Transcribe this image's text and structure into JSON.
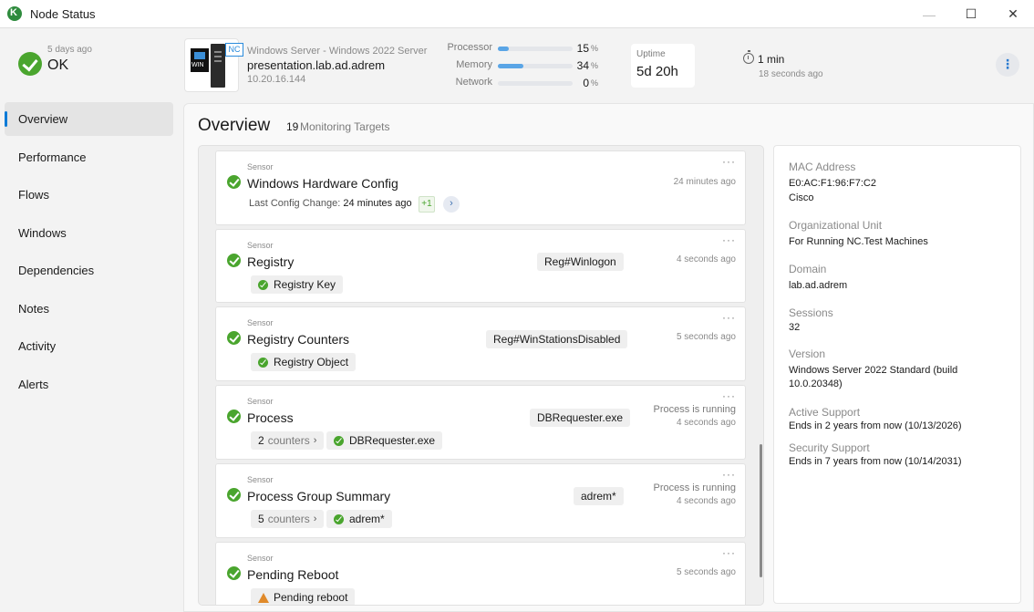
{
  "window": {
    "title": "Node Status",
    "minimize": "—",
    "maximize": "☐",
    "close": "✕"
  },
  "status": {
    "time": "5 days ago",
    "label": "OK"
  },
  "nav": [
    "Overview",
    "Performance",
    "Flows",
    "Windows",
    "Dependencies",
    "Notes",
    "Activity",
    "Alerts"
  ],
  "header": {
    "nc_badge": "NC",
    "win_text": "WIN",
    "os": "Windows Server - Windows 2022 Server",
    "host": "presentation.lab.ad.adrem",
    "ip": "10.20.16.144",
    "metrics": [
      {
        "label": "Processor",
        "value": "15",
        "unit": "%",
        "fraction": 0.15
      },
      {
        "label": "Memory",
        "value": "34",
        "unit": "%",
        "fraction": 0.34
      },
      {
        "label": "Network",
        "value": "0",
        "unit": "%",
        "fraction": 0.0
      }
    ],
    "uptime_label": "Uptime",
    "uptime_value": "5d 20h",
    "timer_value": "1 min",
    "timer_sub": "18 seconds ago",
    "more": "⋮"
  },
  "main": {
    "title": "Overview",
    "target_count": "19",
    "target_label": "Monitoring Targets"
  },
  "cards": [
    {
      "sensor": "Sensor",
      "name": "Windows Hardware Config",
      "time": "24 minutes ago",
      "cfg_label": "Last Config Change:",
      "cfg_value": "24 minutes ago",
      "plus": "+1",
      "next": "›"
    },
    {
      "sensor": "Sensor",
      "name": "Registry",
      "tag": "Reg#Winlogon",
      "time": "4 seconds ago",
      "chip": "Registry Key"
    },
    {
      "sensor": "Sensor",
      "name": "Registry Counters",
      "tag": "Reg#WinStationsDisabled",
      "time": "5 seconds ago",
      "chip": "Registry Object"
    },
    {
      "sensor": "Sensor",
      "name": "Process",
      "tag": "DBRequester.exe",
      "status": "Process is running",
      "time": "4 seconds ago",
      "counter_num": "2",
      "counter_unit": "counters",
      "chip": "DBRequester.exe"
    },
    {
      "sensor": "Sensor",
      "name": "Process Group Summary",
      "tag": "adrem*",
      "status": "Process is running",
      "time": "4 seconds ago",
      "counter_num": "5",
      "counter_unit": "counters",
      "chip": "adrem*"
    },
    {
      "sensor": "Sensor",
      "name": "Pending Reboot",
      "time": "5 seconds ago",
      "chip": "Pending reboot"
    }
  ],
  "card_dots": "···",
  "chevron": "›",
  "info": [
    {
      "label": "MAC Address",
      "value": "E0:AC:F1:96:F7:C2",
      "sub": "Cisco"
    },
    {
      "label": "Organizational Unit",
      "value": "For Running NC.Test Machines"
    },
    {
      "label": "Domain",
      "value": "lab.ad.adrem"
    },
    {
      "label": "Sessions",
      "value": "32"
    },
    {
      "label": "Version",
      "value": "Windows Server 2022 Standard (build 10.0.20348)"
    },
    {
      "label": "Active Support",
      "value": "Ends in 2 years from now (10/13/2026)"
    },
    {
      "label": "Security Support",
      "value": "Ends in 7 years from now (10/14/2031)"
    }
  ],
  "colors": {
    "accent": "#0a7bd7",
    "ok": "#4aa52e",
    "warning": "#e08a2a",
    "bar": "#5aa5e6"
  }
}
